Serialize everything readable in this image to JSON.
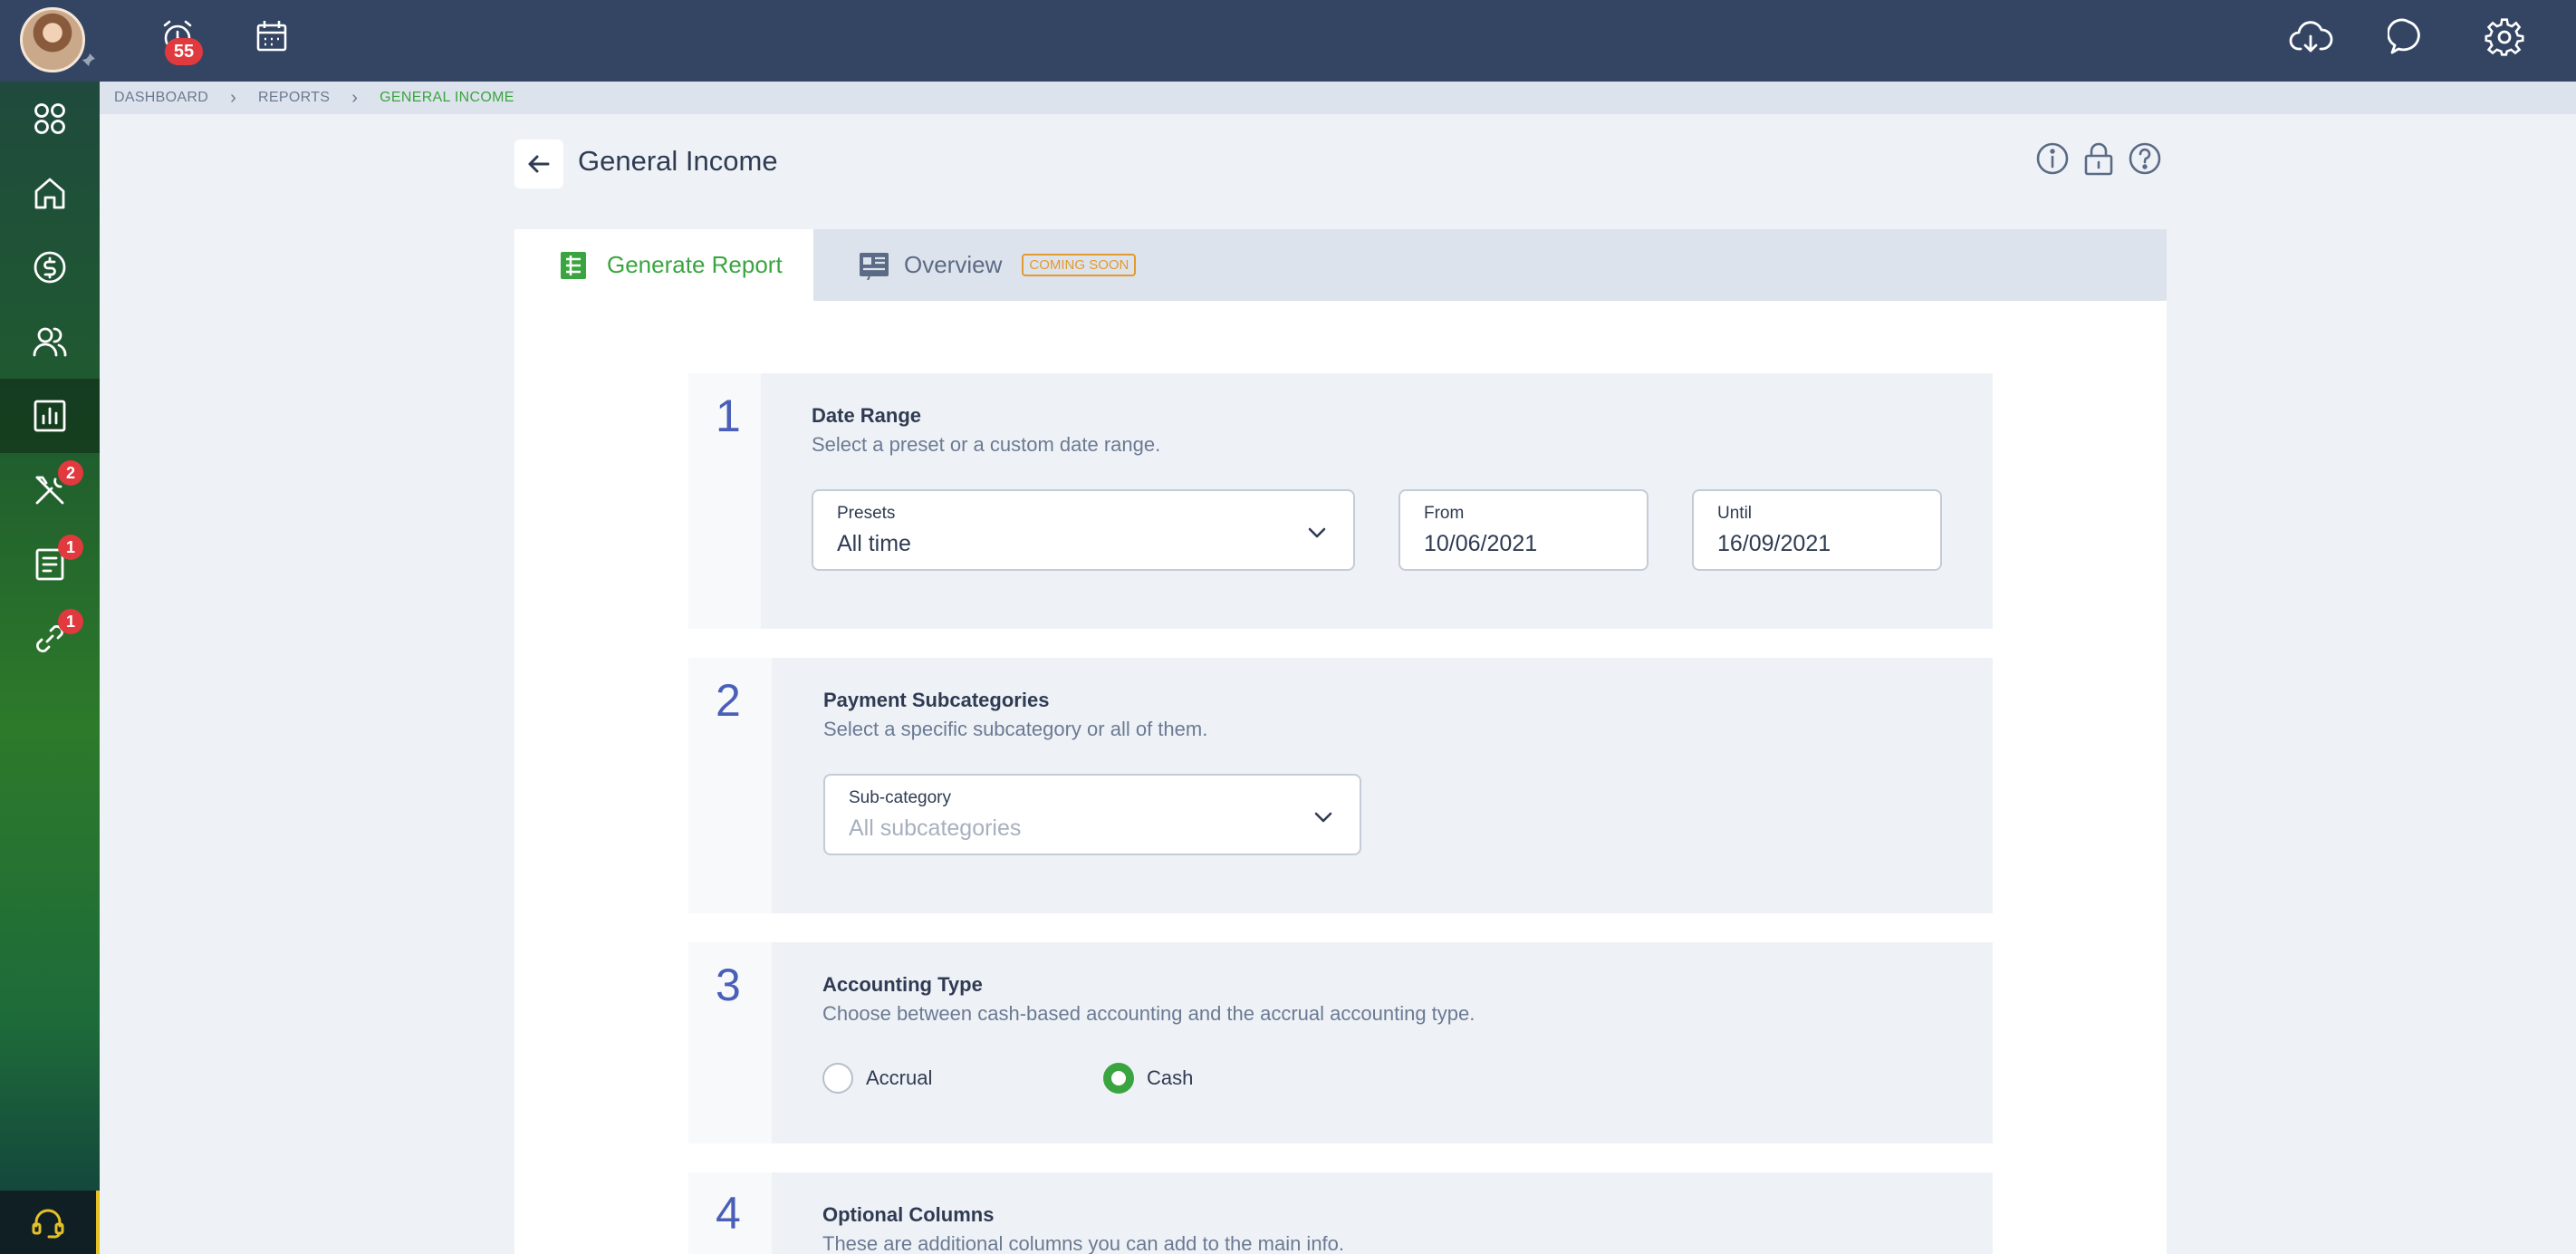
{
  "topbar": {
    "notification_count": "55",
    "icons": [
      "alarm-icon",
      "calendar-icon",
      "cloud-download-icon",
      "chat-icon",
      "settings-icon"
    ]
  },
  "sidebar": {
    "items": [
      {
        "name": "apps-icon"
      },
      {
        "name": "home-icon"
      },
      {
        "name": "dollar-icon"
      },
      {
        "name": "users-icon"
      },
      {
        "name": "reports-icon",
        "active": true
      },
      {
        "name": "tools-icon",
        "badge": "2"
      },
      {
        "name": "document-icon",
        "badge": "1"
      },
      {
        "name": "link-icon",
        "badge": "1"
      }
    ]
  },
  "breadcrumb": {
    "items": [
      "DASHBOARD",
      "REPORTS",
      "GENERAL INCOME"
    ]
  },
  "page": {
    "title": "General Income"
  },
  "tabs": {
    "generate": "Generate Report",
    "overview": "Overview",
    "coming_soon": "COMING SOON"
  },
  "sections": {
    "date_range": {
      "number": "1",
      "title": "Date Range",
      "subtitle": "Select a preset or a custom date range.",
      "presets_label": "Presets",
      "presets_value": "All time",
      "from_label": "From",
      "from_value": "10/06/2021",
      "until_label": "Until",
      "until_value": "16/09/2021"
    },
    "payment": {
      "number": "2",
      "title": "Payment Subcategories",
      "subtitle": "Select a specific subcategory or all of them.",
      "sub_label": "Sub-category",
      "sub_placeholder": "All subcategories"
    },
    "accounting": {
      "number": "3",
      "title": "Accounting Type",
      "subtitle": "Choose between cash-based accounting and the accrual accounting type.",
      "option_accrual": "Accrual",
      "option_cash": "Cash",
      "selected": "Cash"
    },
    "optional": {
      "number": "4",
      "title": "Optional Columns",
      "subtitle": "These are additional columns you can add to the main info."
    }
  },
  "colors": {
    "topbar": "#344563",
    "accent_green": "#3aa540",
    "badge_red": "#e0393e",
    "number_blue": "#4a5fb8",
    "coming_soon_orange": "#e39a2d"
  }
}
